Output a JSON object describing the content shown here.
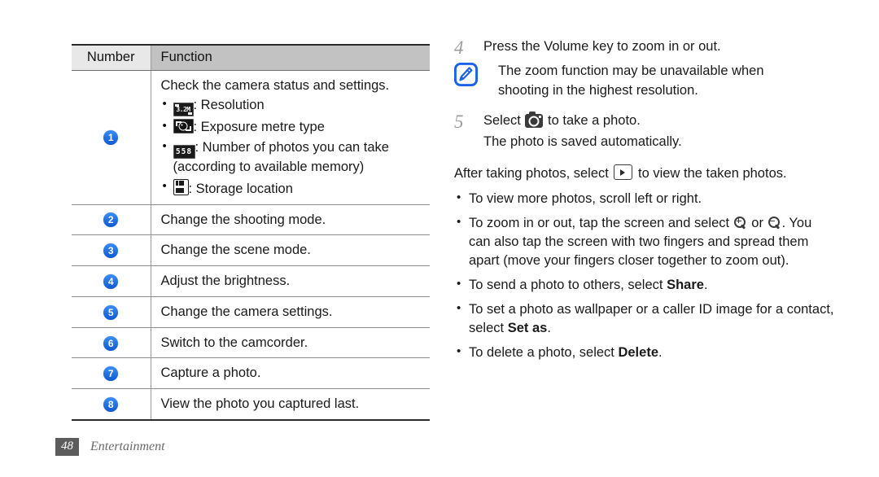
{
  "table": {
    "headers": {
      "number": "Number",
      "function": "Function"
    },
    "rows": [
      {
        "number": "1",
        "heading": "Check the camera status and settings.",
        "items": [
          {
            "icon": "resolution-icon",
            "icon_text": "3.2M",
            "text": ": Resolution"
          },
          {
            "icon": "exposure-metre-icon",
            "icon_text": "",
            "text": ": Exposure metre type"
          },
          {
            "icon": "photo-count-icon",
            "icon_text": "558",
            "text": ": Number of photos you can take (according to available memory)"
          },
          {
            "icon": "storage-location-icon",
            "icon_text": "",
            "text": ": Storage location"
          }
        ]
      },
      {
        "number": "2",
        "text": "Change the shooting mode."
      },
      {
        "number": "3",
        "text": "Change the scene mode."
      },
      {
        "number": "4",
        "text": "Adjust the brightness."
      },
      {
        "number": "5",
        "text": "Change the camera settings."
      },
      {
        "number": "6",
        "text": "Switch to the camcorder."
      },
      {
        "number": "7",
        "text": "Capture a photo."
      },
      {
        "number": "8",
        "text": "View the photo you captured last."
      }
    ]
  },
  "instructions": {
    "step4": {
      "num": "4",
      "text": "Press the Volume key to zoom in or out."
    },
    "note": {
      "icon": "note-pencil-icon",
      "line1": "The zoom function may be unavailable when",
      "line2": "shooting in the highest resolution."
    },
    "step5": {
      "num": "5",
      "text_before": "Select",
      "icon": "camera-icon",
      "text_after": "to take a photo.",
      "subtext": "The photo is saved automatically."
    },
    "after_para": {
      "before": "After taking photos, select",
      "icon": "play-arrow-icon",
      "after": "to view the taken photos."
    },
    "bullets": [
      {
        "id": "scroll",
        "text": "To view more photos, scroll left or right."
      },
      {
        "id": "zoom",
        "before": "To zoom in or out, tap the screen and select",
        "icon_in": "magnifier-plus-icon",
        "middle": "or",
        "icon_out": "magnifier-minus-icon",
        "after": ". You can also tap the screen with two fingers and spread them apart (move your fingers closer together to zoom out)."
      },
      {
        "id": "share",
        "before": "To send a photo to others, select",
        "bold": "Share",
        "after": "."
      },
      {
        "id": "setas",
        "before": "To set a photo as wallpaper or a caller ID image for a contact, select",
        "bold": "Set as",
        "after": "."
      },
      {
        "id": "delete",
        "before": "To delete a photo, select",
        "bold": "Delete",
        "after": "."
      }
    ]
  },
  "footer": {
    "page": "48",
    "chapter": "Entertainment"
  },
  "colors": {
    "badge_blue": "#1168e8",
    "note_blue": "#1a62e8",
    "header_number_bg": "#e8e8e8",
    "header_function_bg": "#c2c2c2",
    "footer_page_bg": "#5c5c5c"
  }
}
